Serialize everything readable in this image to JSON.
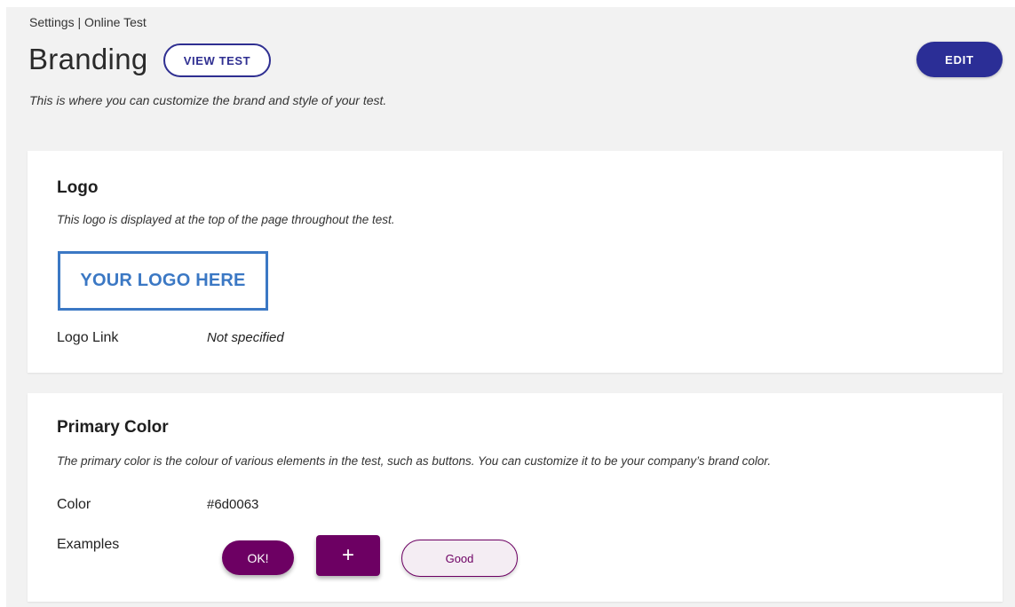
{
  "breadcrumb": "Settings | Online Test",
  "header": {
    "title": "Branding",
    "view_test_label": "VIEW TEST",
    "edit_label": "EDIT",
    "description": "This is where you can customize the brand and style of your test."
  },
  "logo_section": {
    "title": "Logo",
    "description": "This logo is displayed at the top of the page throughout the test.",
    "logo_placeholder": "YOUR LOGO HERE",
    "link_label": "Logo Link",
    "link_value": "Not specified"
  },
  "color_section": {
    "title": "Primary Color",
    "description": "The primary color is the colour of various elements in the test, such as buttons. You can customize it to be your company’s brand color.",
    "color_label": "Color",
    "color_value": "#6d0063",
    "examples_label": "Examples",
    "examples": {
      "ok_label": "OK!",
      "plus_label": "+",
      "good_label": "Good"
    }
  },
  "colors": {
    "primary": "#6d0063",
    "accent": "#2b2e96",
    "logo_blue": "#3b78c4",
    "page_background": "#f2f2f2"
  }
}
